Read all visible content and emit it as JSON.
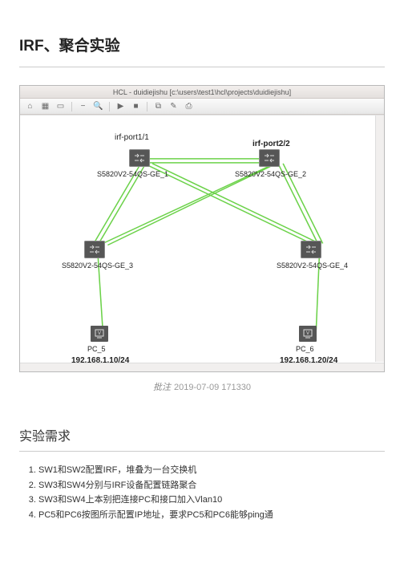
{
  "title": "IRF、聚合实验",
  "hcl": {
    "windowTitle": "HCL - duidiejishu [c:\\users\\test1\\hcl\\projects\\duidiejishu]",
    "portLabels": {
      "left": "irf-port1/1",
      "right": "irf-port2/2"
    },
    "switches": {
      "sw1": "S5820V2-54QS-GE_1",
      "sw2": "S5820V2-54QS-GE_2",
      "sw3": "S5820V2-54QS-GE_3",
      "sw4": "S5820V2-54QS-GE_4"
    },
    "pcs": {
      "pc5": {
        "name": "PC_5",
        "ip": "192.168.1.10/24"
      },
      "pc6": {
        "name": "PC_6",
        "ip": "192.168.1.20/24"
      }
    }
  },
  "caption": {
    "prefix": "批注",
    "text": "2019-07-09 171330"
  },
  "reqTitle": "实验需求",
  "reqs": [
    "SW1和SW2配置IRF，堆叠为一台交换机",
    "SW3和SW4分别与IRF设备配置链路聚合",
    "SW3和SW4上本别把连接PC和接口加入Vlan10",
    "PC5和PC6按图所示配置IP地址，要求PC5和PC6能够ping通"
  ]
}
